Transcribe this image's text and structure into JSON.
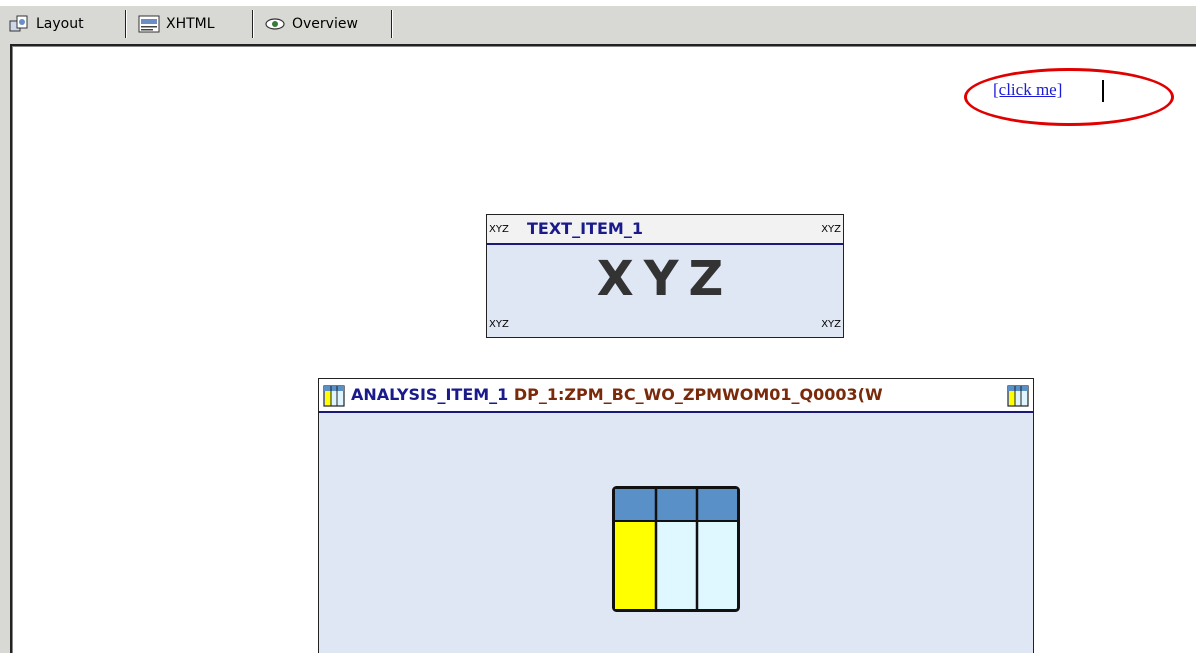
{
  "tabs": [
    {
      "label": "Layout",
      "icon": "layout-icon"
    },
    {
      "label": "XHTML",
      "icon": "xhtml-icon"
    },
    {
      "label": "Overview",
      "icon": "eye-icon"
    }
  ],
  "canvas": {
    "link_text": "[click me]",
    "highlight_color": "#e00000"
  },
  "text_item": {
    "title": "TEXT_ITEM_1",
    "corner_label": "XYZ",
    "content": "XYZ"
  },
  "analysis_item": {
    "title": "ANALYSIS_ITEM_1",
    "data_provider": "DP_1:ZPM_BC_WO_ZPMWOM01_Q0003(W"
  },
  "colors": {
    "item_background": "#dfe6f4",
    "title_blue": "#1a1a8a",
    "dp_brown": "#7a2a0a",
    "link_blue": "#1a1ad9"
  }
}
